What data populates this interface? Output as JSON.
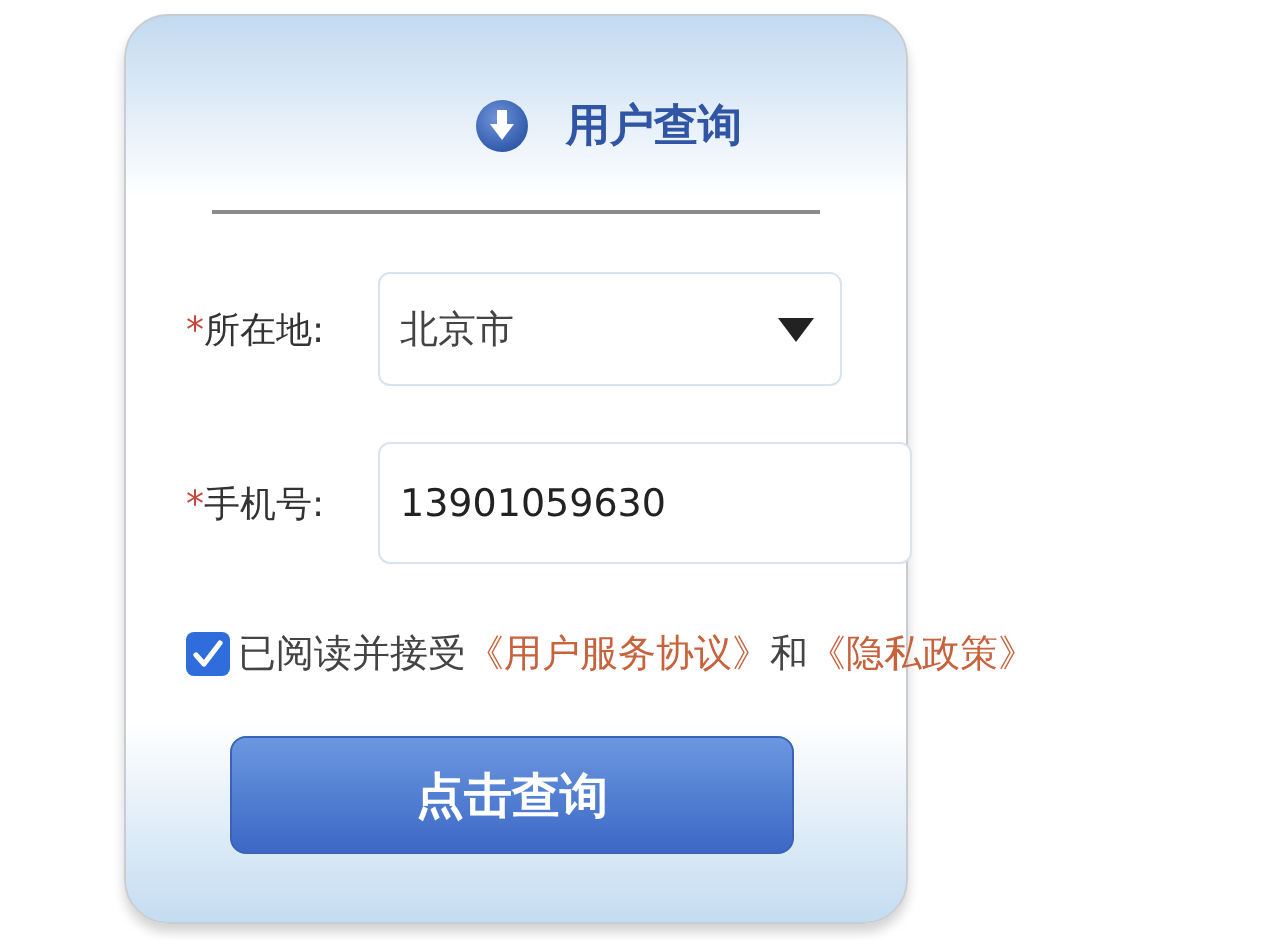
{
  "header": {
    "title": "用户查询"
  },
  "fields": [
    {
      "kind": "select",
      "required_mark": "*",
      "label": "所在地:",
      "value": "北京市"
    },
    {
      "kind": "text",
      "required_mark": "*",
      "label": "手机号:",
      "value": "13901059630"
    }
  ],
  "consent": {
    "checked": true,
    "parts": [
      {
        "kind": "text",
        "text": "已阅读并接受"
      },
      {
        "kind": "link",
        "text": "《用户服务协议》"
      },
      {
        "kind": "text",
        "text": "和"
      },
      {
        "kind": "link",
        "text": "《隐私政策》"
      }
    ]
  },
  "submit_button": {
    "label": "点击查询"
  }
}
